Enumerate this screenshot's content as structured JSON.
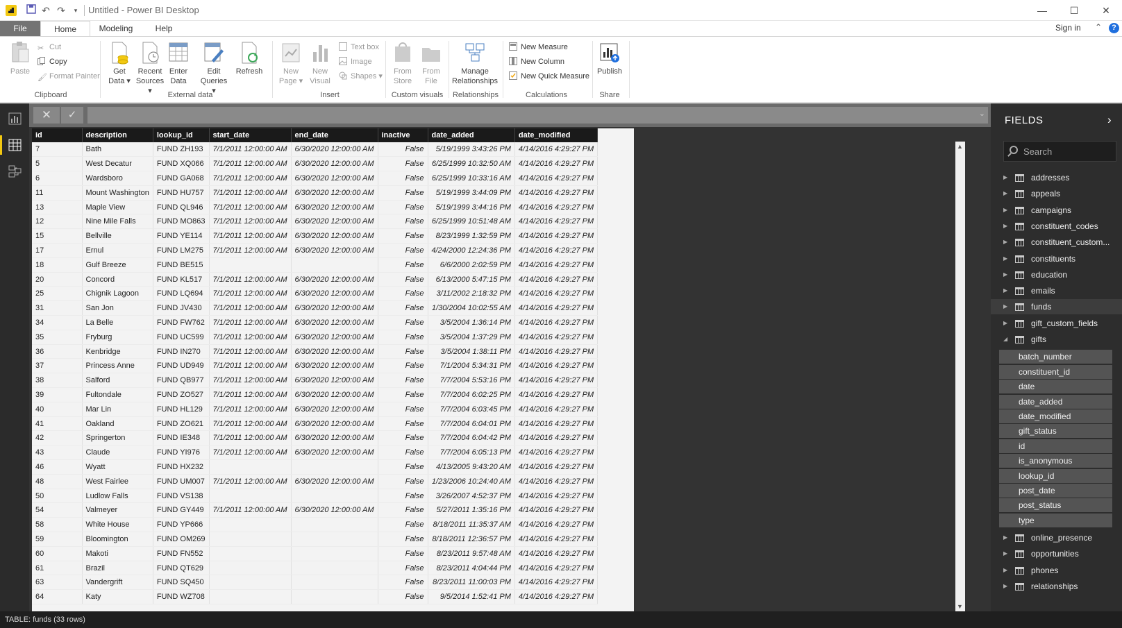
{
  "window": {
    "title": "Untitled - Power BI Desktop",
    "minimize_glyph": "—",
    "maximize_glyph": "☐",
    "close_glyph": "✕"
  },
  "quick_access": {
    "save_icon": "save-icon",
    "undo_icon": "undo-icon",
    "redo_icon": "redo-icon",
    "customize_icon": "customize-icon"
  },
  "tabs": {
    "file": "File",
    "home": "Home",
    "modeling": "Modeling",
    "help": "Help",
    "sign_in": "Sign in"
  },
  "ribbon": {
    "clipboard": {
      "paste": "Paste",
      "cut": "Cut",
      "copy": "Copy",
      "format_painter": "Format Painter",
      "label": "Clipboard"
    },
    "external_data": {
      "get_data_1": "Get",
      "get_data_2": "Data",
      "recent_1": "Recent",
      "recent_2": "Sources",
      "enter_1": "Enter",
      "enter_2": "Data",
      "edit_1": "Edit",
      "edit_2": "Queries",
      "refresh": "Refresh",
      "label": "External data"
    },
    "insert": {
      "new_page_1": "New",
      "new_page_2": "Page",
      "new_visual_1": "New",
      "new_visual_2": "Visual",
      "text_box": "Text box",
      "image": "Image",
      "shapes": "Shapes",
      "label": "Insert"
    },
    "custom_visuals": {
      "from_store_1": "From",
      "from_store_2": "Store",
      "from_file_1": "From",
      "from_file_2": "File",
      "label": "Custom visuals"
    },
    "relationships": {
      "manage_1": "Manage",
      "manage_2": "Relationships",
      "label": "Relationships"
    },
    "calculations": {
      "new_measure": "New Measure",
      "new_column": "New Column",
      "new_quick_measure": "New Quick Measure",
      "label": "Calculations"
    },
    "share": {
      "publish": "Publish",
      "label": "Share"
    }
  },
  "formula_bar": {
    "cancel_glyph": "✕",
    "commit_glyph": "✓",
    "expand_glyph": "⌄"
  },
  "table": {
    "columns": [
      "id",
      "description",
      "lookup_id",
      "start_date",
      "end_date",
      "inactive",
      "date_added",
      "date_modified"
    ],
    "rows": [
      [
        "7",
        "Bath",
        "FUND ZH193",
        "7/1/2011 12:00:00 AM",
        "6/30/2020 12:00:00 AM",
        "False",
        "5/19/1999 3:43:26 PM",
        "4/14/2016 4:29:27 PM"
      ],
      [
        "5",
        "West Decatur",
        "FUND XQ066",
        "7/1/2011 12:00:00 AM",
        "6/30/2020 12:00:00 AM",
        "False",
        "6/25/1999 10:32:50 AM",
        "4/14/2016 4:29:27 PM"
      ],
      [
        "6",
        "Wardsboro",
        "FUND GA068",
        "7/1/2011 12:00:00 AM",
        "6/30/2020 12:00:00 AM",
        "False",
        "6/25/1999 10:33:16 AM",
        "4/14/2016 4:29:27 PM"
      ],
      [
        "11",
        "Mount Washington",
        "FUND HU757",
        "7/1/2011 12:00:00 AM",
        "6/30/2020 12:00:00 AM",
        "False",
        "5/19/1999 3:44:09 PM",
        "4/14/2016 4:29:27 PM"
      ],
      [
        "13",
        "Maple View",
        "FUND QL946",
        "7/1/2011 12:00:00 AM",
        "6/30/2020 12:00:00 AM",
        "False",
        "5/19/1999 3:44:16 PM",
        "4/14/2016 4:29:27 PM"
      ],
      [
        "12",
        "Nine Mile Falls",
        "FUND MO863",
        "7/1/2011 12:00:00 AM",
        "6/30/2020 12:00:00 AM",
        "False",
        "6/25/1999 10:51:48 AM",
        "4/14/2016 4:29:27 PM"
      ],
      [
        "15",
        "Bellville",
        "FUND YE114",
        "7/1/2011 12:00:00 AM",
        "6/30/2020 12:00:00 AM",
        "False",
        "8/23/1999 1:32:59 PM",
        "4/14/2016 4:29:27 PM"
      ],
      [
        "17",
        "Ernul",
        "FUND LM275",
        "7/1/2011 12:00:00 AM",
        "6/30/2020 12:00:00 AM",
        "False",
        "4/24/2000 12:24:36 PM",
        "4/14/2016 4:29:27 PM"
      ],
      [
        "18",
        "Gulf Breeze",
        "FUND BE515",
        "",
        "",
        "False",
        "6/6/2000 2:02:59 PM",
        "4/14/2016 4:29:27 PM"
      ],
      [
        "20",
        "Concord",
        "FUND KL517",
        "7/1/2011 12:00:00 AM",
        "6/30/2020 12:00:00 AM",
        "False",
        "6/13/2000 5:47:15 PM",
        "4/14/2016 4:29:27 PM"
      ],
      [
        "25",
        "Chignik Lagoon",
        "FUND LQ694",
        "7/1/2011 12:00:00 AM",
        "6/30/2020 12:00:00 AM",
        "False",
        "3/11/2002 2:18:32 PM",
        "4/14/2016 4:29:27 PM"
      ],
      [
        "31",
        "San Jon",
        "FUND JV430",
        "7/1/2011 12:00:00 AM",
        "6/30/2020 12:00:00 AM",
        "False",
        "1/30/2004 10:02:55 AM",
        "4/14/2016 4:29:27 PM"
      ],
      [
        "34",
        "La Belle",
        "FUND FW762",
        "7/1/2011 12:00:00 AM",
        "6/30/2020 12:00:00 AM",
        "False",
        "3/5/2004 1:36:14 PM",
        "4/14/2016 4:29:27 PM"
      ],
      [
        "35",
        "Fryburg",
        "FUND UC599",
        "7/1/2011 12:00:00 AM",
        "6/30/2020 12:00:00 AM",
        "False",
        "3/5/2004 1:37:29 PM",
        "4/14/2016 4:29:27 PM"
      ],
      [
        "36",
        "Kenbridge",
        "FUND IN270",
        "7/1/2011 12:00:00 AM",
        "6/30/2020 12:00:00 AM",
        "False",
        "3/5/2004 1:38:11 PM",
        "4/14/2016 4:29:27 PM"
      ],
      [
        "37",
        "Princess Anne",
        "FUND UD949",
        "7/1/2011 12:00:00 AM",
        "6/30/2020 12:00:00 AM",
        "False",
        "7/1/2004 5:34:31 PM",
        "4/14/2016 4:29:27 PM"
      ],
      [
        "38",
        "Salford",
        "FUND QB977",
        "7/1/2011 12:00:00 AM",
        "6/30/2020 12:00:00 AM",
        "False",
        "7/7/2004 5:53:16 PM",
        "4/14/2016 4:29:27 PM"
      ],
      [
        "39",
        "Fultondale",
        "FUND ZO527",
        "7/1/2011 12:00:00 AM",
        "6/30/2020 12:00:00 AM",
        "False",
        "7/7/2004 6:02:25 PM",
        "4/14/2016 4:29:27 PM"
      ],
      [
        "40",
        "Mar Lin",
        "FUND HL129",
        "7/1/2011 12:00:00 AM",
        "6/30/2020 12:00:00 AM",
        "False",
        "7/7/2004 6:03:45 PM",
        "4/14/2016 4:29:27 PM"
      ],
      [
        "41",
        "Oakland",
        "FUND ZO621",
        "7/1/2011 12:00:00 AM",
        "6/30/2020 12:00:00 AM",
        "False",
        "7/7/2004 6:04:01 PM",
        "4/14/2016 4:29:27 PM"
      ],
      [
        "42",
        "Springerton",
        "FUND IE348",
        "7/1/2011 12:00:00 AM",
        "6/30/2020 12:00:00 AM",
        "False",
        "7/7/2004 6:04:42 PM",
        "4/14/2016 4:29:27 PM"
      ],
      [
        "43",
        "Claude",
        "FUND YI976",
        "7/1/2011 12:00:00 AM",
        "6/30/2020 12:00:00 AM",
        "False",
        "7/7/2004 6:05:13 PM",
        "4/14/2016 4:29:27 PM"
      ],
      [
        "46",
        "Wyatt",
        "FUND HX232",
        "",
        "",
        "False",
        "4/13/2005 9:43:20 AM",
        "4/14/2016 4:29:27 PM"
      ],
      [
        "48",
        "West Fairlee",
        "FUND UM007",
        "7/1/2011 12:00:00 AM",
        "6/30/2020 12:00:00 AM",
        "False",
        "1/23/2006 10:24:40 AM",
        "4/14/2016 4:29:27 PM"
      ],
      [
        "50",
        "Ludlow Falls",
        "FUND VS138",
        "",
        "",
        "False",
        "3/26/2007 4:52:37 PM",
        "4/14/2016 4:29:27 PM"
      ],
      [
        "54",
        "Valmeyer",
        "FUND GY449",
        "7/1/2011 12:00:00 AM",
        "6/30/2020 12:00:00 AM",
        "False",
        "5/27/2011 1:35:16 PM",
        "4/14/2016 4:29:27 PM"
      ],
      [
        "58",
        "White House",
        "FUND YP666",
        "",
        "",
        "False",
        "8/18/2011 11:35:37 AM",
        "4/14/2016 4:29:27 PM"
      ],
      [
        "59",
        "Bloomington",
        "FUND OM269",
        "",
        "",
        "False",
        "8/18/2011 12:36:57 PM",
        "4/14/2016 4:29:27 PM"
      ],
      [
        "60",
        "Makoti",
        "FUND FN552",
        "",
        "",
        "False",
        "8/23/2011 9:57:48 AM",
        "4/14/2016 4:29:27 PM"
      ],
      [
        "61",
        "Brazil",
        "FUND QT629",
        "",
        "",
        "False",
        "8/23/2011 4:04:44 PM",
        "4/14/2016 4:29:27 PM"
      ],
      [
        "63",
        "Vandergrift",
        "FUND SQ450",
        "",
        "",
        "False",
        "8/23/2011 11:00:03 PM",
        "4/14/2016 4:29:27 PM"
      ],
      [
        "64",
        "Katy",
        "FUND WZ708",
        "",
        "",
        "False",
        "9/5/2014 1:52:41 PM",
        "4/14/2016 4:29:27 PM"
      ]
    ]
  },
  "fields_pane": {
    "title": "FIELDS",
    "search_placeholder": "Search",
    "tables": [
      "addresses",
      "appeals",
      "campaigns",
      "constituent_codes",
      "constituent_custom...",
      "constituents",
      "education",
      "emails",
      "funds",
      "gift_custom_fields",
      "gifts"
    ],
    "gift_fields": [
      "batch_number",
      "constituent_id",
      "date",
      "date_added",
      "date_modified",
      "gift_status",
      "id",
      "is_anonymous",
      "lookup_id",
      "post_date",
      "post_status",
      "type"
    ],
    "tables_after": [
      "online_presence",
      "opportunities",
      "phones",
      "relationships"
    ],
    "selected_table": "funds",
    "expanded_table": "gifts"
  },
  "status": {
    "text": "TABLE: funds (33 rows)"
  },
  "colors": {
    "accent": "#f2c811",
    "dark_bg": "#2b2b2b",
    "header_bg": "#1a1a1a"
  }
}
